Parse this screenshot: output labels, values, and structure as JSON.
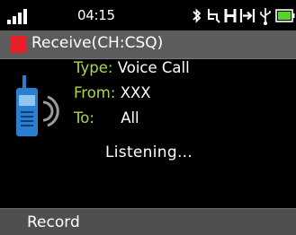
{
  "status": {
    "time": "04:15",
    "icons": [
      "signal-icon",
      "bluetooth-icon",
      "gps-icon",
      "h-icon",
      "tab-icon",
      "usb-icon",
      "battery-icon"
    ]
  },
  "title": {
    "text": "Receive(CH:CSQ)",
    "indicator_color": "#e8202a"
  },
  "call": {
    "type_label": "Type:",
    "type_value": "Voice Call",
    "from_label": "From:",
    "from_value": "XXX",
    "to_label": "To:",
    "to_value": "All",
    "status_text": "Listening..."
  },
  "softkey": {
    "left_label": "Record"
  },
  "colors": {
    "label_green": "#a8d94a",
    "title_bar": "#5c5c5c",
    "bottom_bar": "#4f4f4f",
    "radio_blue": "#2a7fd0",
    "battery_green": "#55d626"
  }
}
